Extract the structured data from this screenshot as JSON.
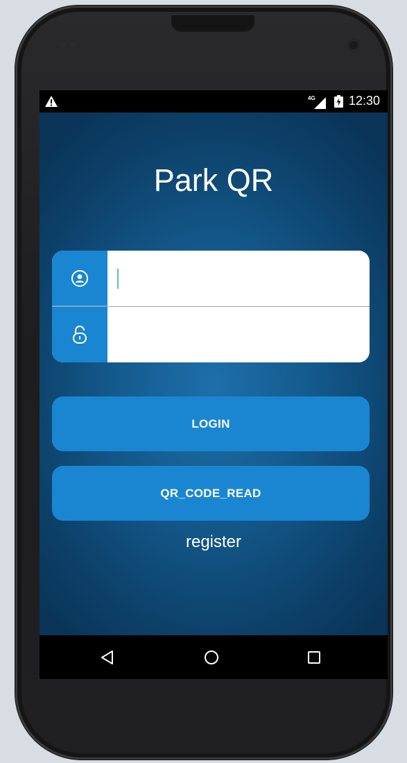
{
  "status_bar": {
    "network": "4G",
    "time": "12:30",
    "icons": [
      "warning-icon",
      "signal-icon",
      "battery-charging-icon"
    ]
  },
  "app": {
    "title": "Park QR"
  },
  "login_form": {
    "username_icon": "user-circle-icon",
    "password_icon": "lock-icon",
    "username_value": "",
    "password_value": ""
  },
  "buttons": {
    "login": "LOGIN",
    "qr_code_read": "QR_CODE_READ",
    "register": "register"
  },
  "nav_bar": {
    "icons": [
      "back-icon",
      "home-icon",
      "recents-icon"
    ]
  },
  "colors": {
    "accent": "#1a86d1",
    "background_center": "#1e6fab",
    "background_edge": "#0a3458",
    "cursor": "#5dc3a7"
  }
}
